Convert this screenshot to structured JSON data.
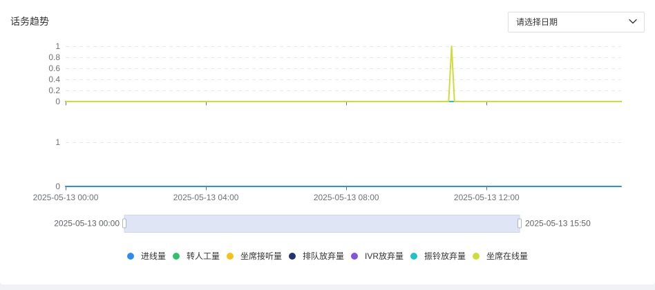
{
  "date_select": {
    "placeholder": "请选择日期",
    "icon": "chevron-down-icon"
  },
  "chart_data": {
    "type": "line",
    "title": "话务趋势",
    "xlim": [
      "2025-05-13 00:00",
      "2025-05-13 15:50"
    ],
    "x_ticks": [
      "2025-05-13 00:00",
      "2025-05-13 04:00",
      "2025-05-13 08:00",
      "2025-05-13 12:00"
    ],
    "x": [
      "2025-05-13 00:00",
      "2025-05-13 10:55",
      "2025-05-13 11:00",
      "2025-05-13 11:05",
      "2025-05-13 15:50"
    ],
    "grid": true,
    "legend_position": "bottom",
    "panels": [
      {
        "ylim": [
          0,
          1
        ],
        "y_ticks": [
          1,
          0.8,
          0.6,
          0.4,
          0.2,
          0
        ]
      },
      {
        "ylim": [
          0,
          1
        ],
        "y_ticks": [
          1,
          0
        ]
      }
    ],
    "series": [
      {
        "name": "进线量",
        "color": "#2d8cf0",
        "panel": 1,
        "values": [
          0,
          0,
          0,
          0,
          0
        ]
      },
      {
        "name": "转人工量",
        "color": "#30c26a",
        "panel": 0,
        "values": [
          0,
          0,
          0,
          0,
          0
        ]
      },
      {
        "name": "坐席接听量",
        "color": "#f5c21b",
        "panel": 0,
        "values": [
          0,
          0,
          0,
          0,
          0
        ]
      },
      {
        "name": "排队放弃量",
        "color": "#233270",
        "panel": 0,
        "values": [
          0,
          0,
          0,
          0,
          0
        ]
      },
      {
        "name": "IVR放弃量",
        "color": "#8452db",
        "panel": 0,
        "values": [
          0,
          0,
          0,
          0,
          0
        ]
      },
      {
        "name": "振铃放弃量",
        "color": "#23c1c6",
        "panel": 0,
        "values": [
          0,
          0,
          0,
          0,
          0
        ]
      },
      {
        "name": "坐席在线量",
        "color": "#cddc39",
        "panel": 0,
        "values": [
          0,
          0,
          1,
          0,
          0
        ]
      }
    ]
  },
  "data_zoom": {
    "start_label": "2025-05-13 00:00",
    "end_label": "2025-05-13 15:50",
    "range_percent": [
      0,
      100
    ]
  }
}
